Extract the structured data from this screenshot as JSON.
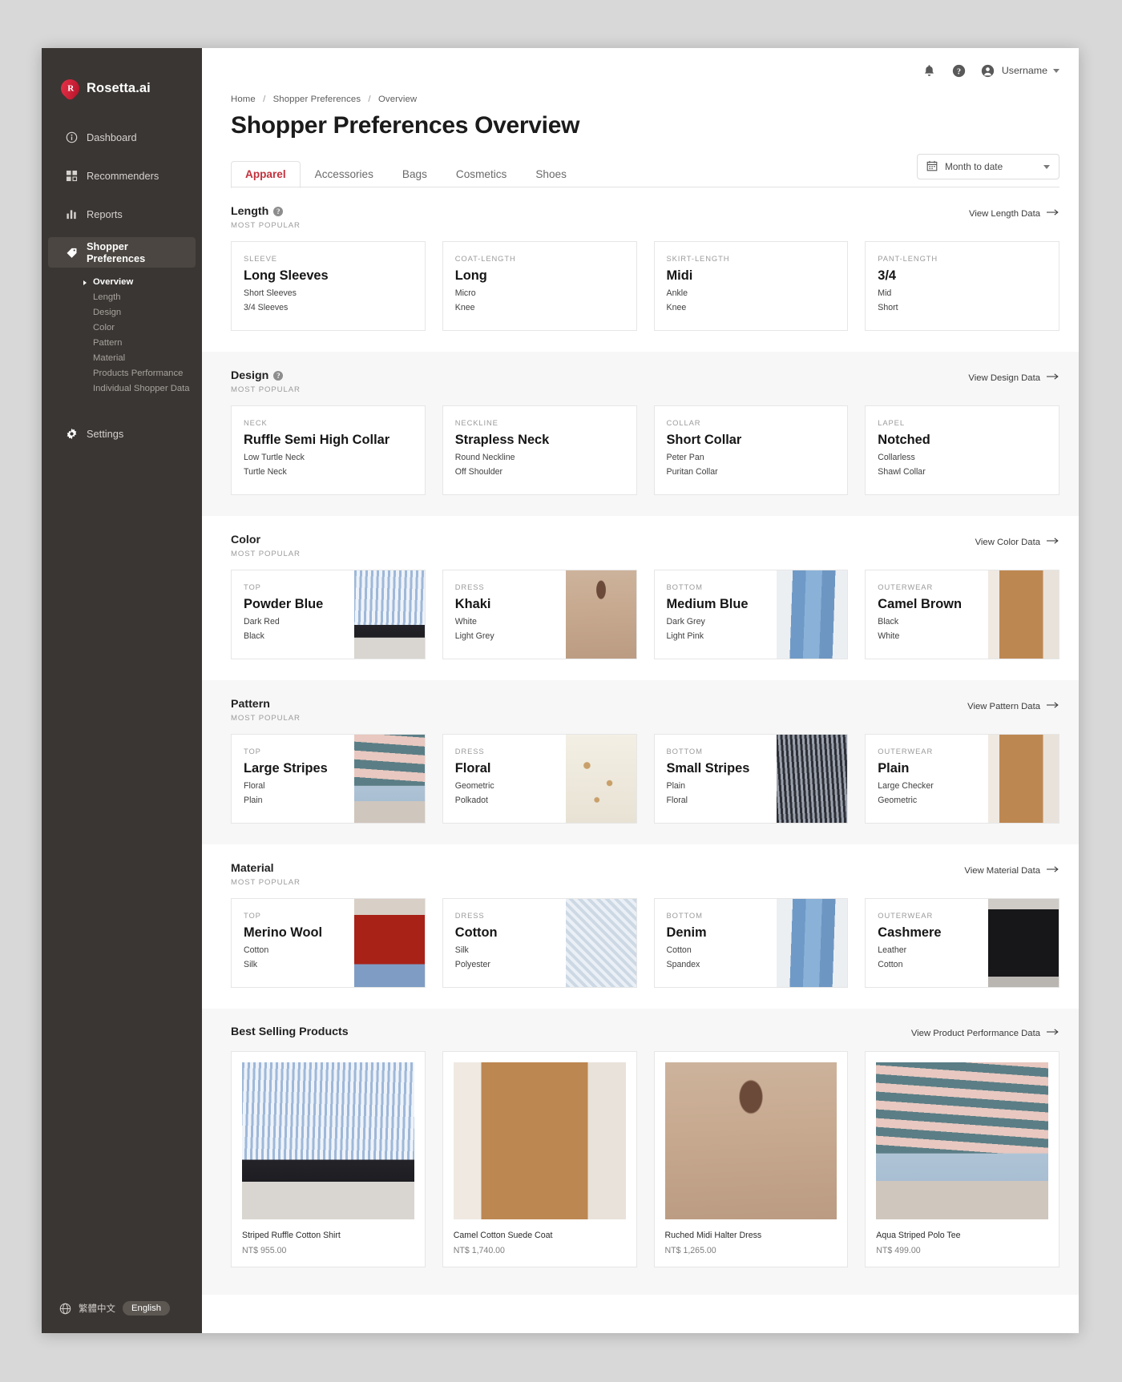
{
  "sidebar": {
    "brand": {
      "name": "Rosetta.ai",
      "logo_icon": "rosetta-logo-icon"
    },
    "items": [
      {
        "label": "Dashboard",
        "icon": "info-circle-icon",
        "active": false
      },
      {
        "label": "Recommenders",
        "icon": "grid-squares-icon",
        "active": false
      },
      {
        "label": "Reports",
        "icon": "bar-chart-icon",
        "active": false
      },
      {
        "label": "Shopper Preferences",
        "icon": "tag-icon",
        "active": true
      }
    ],
    "subitems": [
      {
        "label": "Overview",
        "active": true
      },
      {
        "label": "Length",
        "active": false
      },
      {
        "label": "Design",
        "active": false
      },
      {
        "label": "Color",
        "active": false
      },
      {
        "label": "Pattern",
        "active": false
      },
      {
        "label": "Material",
        "active": false
      },
      {
        "label": "Products Performance",
        "active": false
      },
      {
        "label": "Individual Shopper Data",
        "active": false
      }
    ],
    "settings": {
      "label": "Settings",
      "icon": "gear-icon"
    },
    "language": {
      "globe_icon": "globe-icon",
      "chinese_label": "繁體中文",
      "english_label": "English"
    }
  },
  "topbar": {
    "notification_icon": "bell-icon",
    "help_icon": "question-circle-icon",
    "avatar_icon": "user-avatar-icon",
    "username": "Username",
    "caret_icon": "chevron-down-icon"
  },
  "header": {
    "breadcrumb": [
      "Home",
      "Shopper Preferences",
      "Overview"
    ],
    "breadcrumb_separator": "/",
    "title": "Shopper Preferences Overview"
  },
  "tabs": [
    {
      "label": "Apparel",
      "active": true
    },
    {
      "label": "Accessories",
      "active": false
    },
    {
      "label": "Bags",
      "active": false
    },
    {
      "label": "Cosmetics",
      "active": false
    },
    {
      "label": "Shoes",
      "active": false
    }
  ],
  "date_filter": {
    "calendar_icon": "calendar-icon",
    "value": "Month to date",
    "caret_icon": "caret-down-icon"
  },
  "colors": {
    "accent": "#c3313c",
    "sidebar_bg": "#3a3633",
    "sidebar_active": "#4b4641",
    "shaded_section": "#f7f7f7",
    "card_border": "#e6e6e6"
  },
  "sections": [
    {
      "title": "Length",
      "has_help": true,
      "subtitle": "MOST POPULAR",
      "link": "View Length Data",
      "shaded": false,
      "with_images": false,
      "cards": [
        {
          "category": "SLEEVE",
          "top": "Long Sleeves",
          "alt1": "Short Sleeves",
          "alt2": "3/4 Sleeves"
        },
        {
          "category": "COAT-LENGTH",
          "top": "Long",
          "alt1": "Micro",
          "alt2": "Knee"
        },
        {
          "category": "SKIRT-LENGTH",
          "top": "Midi",
          "alt1": "Ankle",
          "alt2": "Knee"
        },
        {
          "category": "PANT-LENGTH",
          "top": "3/4",
          "alt1": "Mid",
          "alt2": "Short"
        }
      ]
    },
    {
      "title": "Design",
      "has_help": true,
      "subtitle": "MOST POPULAR",
      "link": "View Design Data",
      "shaded": true,
      "with_images": false,
      "cards": [
        {
          "category": "NECK",
          "top": "Ruffle Semi High Collar",
          "alt1": "Low Turtle Neck",
          "alt2": "Turtle Neck"
        },
        {
          "category": "NECKLINE",
          "top": "Strapless Neck",
          "alt1": "Round Neckline",
          "alt2": "Off Shoulder"
        },
        {
          "category": "COLLAR",
          "top": "Short Collar",
          "alt1": "Peter Pan",
          "alt2": "Puritan Collar"
        },
        {
          "category": "LAPEL",
          "top": "Notched",
          "alt1": "Collarless",
          "alt2": "Shawl Collar"
        }
      ]
    },
    {
      "title": "Color",
      "has_help": false,
      "subtitle": "MOST POPULAR",
      "link": "View Color Data",
      "shaded": false,
      "with_images": true,
      "cards": [
        {
          "category": "TOP",
          "top": "Powder Blue",
          "alt1": "Dark Red",
          "alt2": "Black",
          "image": "ph-shirt-blue"
        },
        {
          "category": "DRESS",
          "top": "Khaki",
          "alt1": "White",
          "alt2": "Light Grey",
          "image": "ph-khaki-dress"
        },
        {
          "category": "BOTTOM",
          "top": "Medium Blue",
          "alt1": "Dark Grey",
          "alt2": "Light Pink",
          "image": "ph-jeans"
        },
        {
          "category": "OUTERWEAR",
          "top": "Camel Brown",
          "alt1": "Black",
          "alt2": "White",
          "image": "ph-camel-coat"
        }
      ]
    },
    {
      "title": "Pattern",
      "has_help": false,
      "subtitle": "MOST POPULAR",
      "link": "View Pattern Data",
      "shaded": true,
      "with_images": true,
      "cards": [
        {
          "category": "TOP",
          "top": "Large Stripes",
          "alt1": "Floral",
          "alt2": "Plain",
          "image": "ph-stripe-polo"
        },
        {
          "category": "DRESS",
          "top": "Floral",
          "alt1": "Geometric",
          "alt2": "Polkadot",
          "image": "ph-floral-dress"
        },
        {
          "category": "BOTTOM",
          "top": "Small Stripes",
          "alt1": "Plain",
          "alt2": "Floral",
          "image": "ph-stripe-pants"
        },
        {
          "category": "OUTERWEAR",
          "top": "Plain",
          "alt1": "Large Checker",
          "alt2": "Geometric",
          "image": "ph-camel-coat"
        }
      ]
    },
    {
      "title": "Material",
      "has_help": false,
      "subtitle": "MOST POPULAR",
      "link": "View Material Data",
      "shaded": false,
      "with_images": true,
      "cards": [
        {
          "category": "TOP",
          "top": "Merino Wool",
          "alt1": "Cotton",
          "alt2": "Silk",
          "image": "ph-red-sweater"
        },
        {
          "category": "DRESS",
          "top": "Cotton",
          "alt1": "Silk",
          "alt2": "Polyester",
          "image": "ph-lace-dress"
        },
        {
          "category": "BOTTOM",
          "top": "Denim",
          "alt1": "Cotton",
          "alt2": "Spandex",
          "image": "ph-jeans"
        },
        {
          "category": "OUTERWEAR",
          "top": "Cashmere",
          "alt1": "Leather",
          "alt2": "Cotton",
          "image": "ph-black-coat"
        }
      ]
    }
  ],
  "best_selling": {
    "title": "Best Selling Products",
    "link": "View Product Performance Data",
    "products": [
      {
        "name": "Striped Ruffle Cotton Shirt",
        "price": "NT$ 955.00",
        "image": "ph-shirt-blue"
      },
      {
        "name": "Camel Cotton Suede Coat",
        "price": "NT$ 1,740.00",
        "image": "ph-camel-coat"
      },
      {
        "name": "Ruched Midi Halter Dress",
        "price": "NT$ 1,265.00",
        "image": "ph-khaki-dress"
      },
      {
        "name": "Aqua Striped Polo Tee",
        "price": "NT$ 499.00",
        "image": "ph-stripe-polo"
      }
    ]
  }
}
